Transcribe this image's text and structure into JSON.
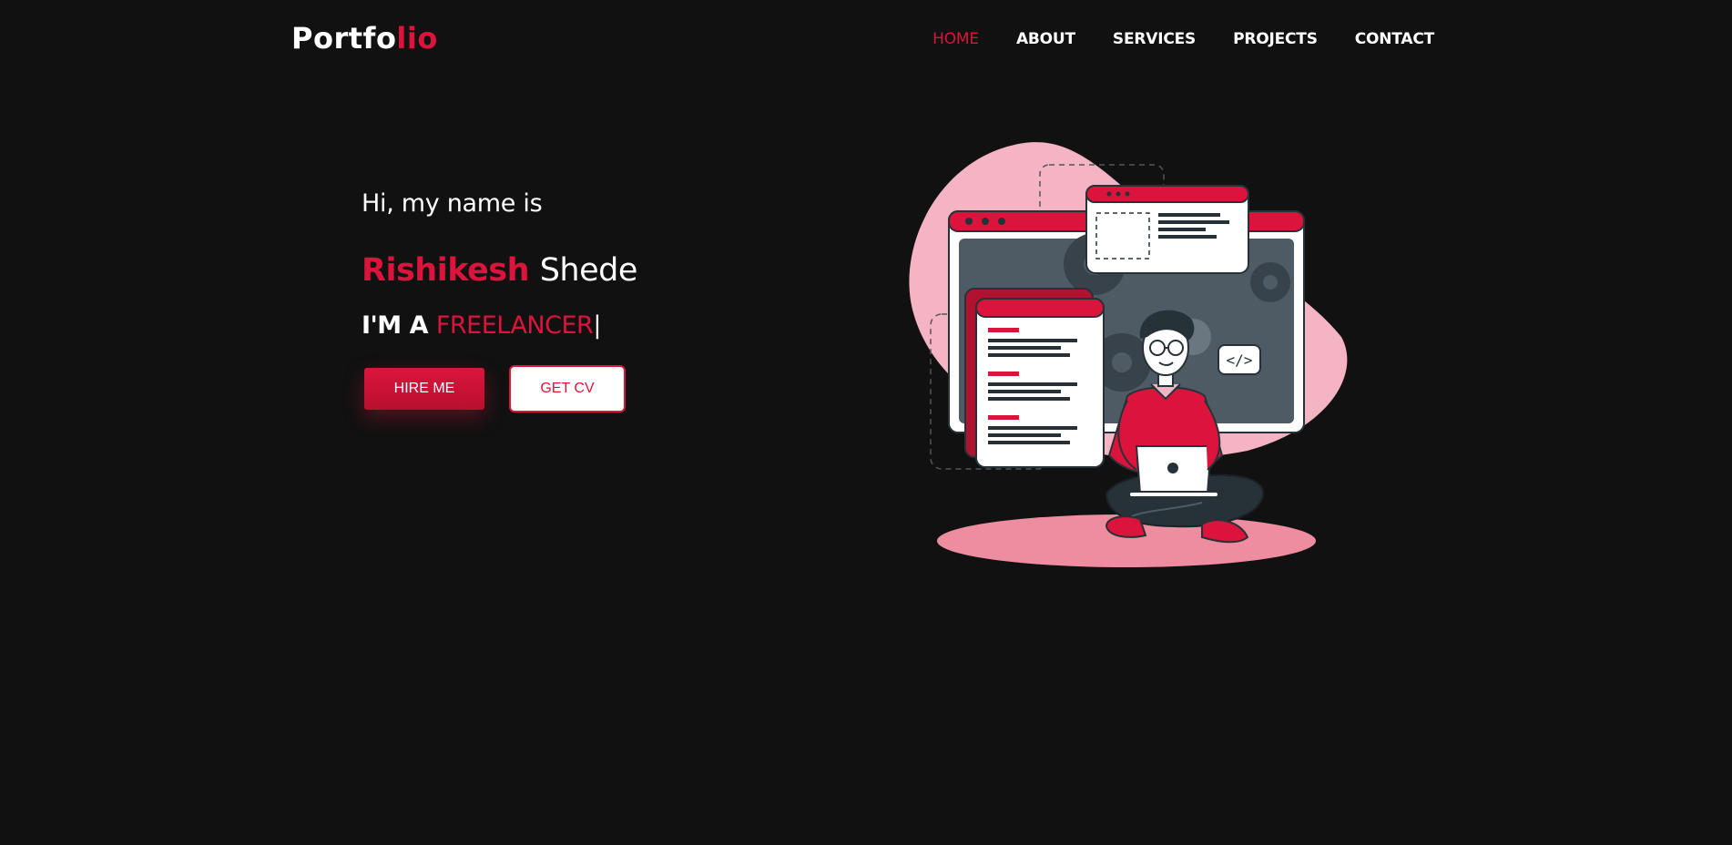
{
  "brand": {
    "logo_main": "Portfo",
    "logo_accent": "lio"
  },
  "nav": {
    "items": [
      {
        "label": "HOME",
        "active": true
      },
      {
        "label": "ABOUT",
        "active": false
      },
      {
        "label": "SERVICES",
        "active": false
      },
      {
        "label": "PROJECTS",
        "active": false
      },
      {
        "label": "CONTACT",
        "active": false
      }
    ]
  },
  "hero": {
    "greeting": "Hi, my name is",
    "first_name": "Rishikesh",
    "last_name": "Shede",
    "role_prefix": "I'M A",
    "role_typed": "FREELANCER",
    "cursor": "|",
    "hire_label": "HIRE ME",
    "cv_label": "GET CV"
  },
  "illustration": {
    "code_badge": "</>",
    "icon": "developer-with-laptop-illustration"
  },
  "colors": {
    "accent": "#dc143c",
    "background": "#111111",
    "blob": "#f4b4c3",
    "text": "#ffffff"
  }
}
